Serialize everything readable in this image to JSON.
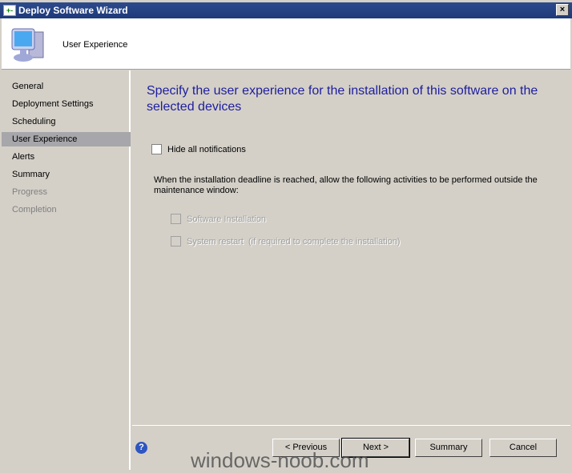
{
  "window": {
    "title": "Deploy Software Wizard",
    "close": "×"
  },
  "header": {
    "title": "User Experience"
  },
  "sidebar": {
    "items": [
      {
        "label": "General"
      },
      {
        "label": "Deployment Settings"
      },
      {
        "label": "Scheduling"
      },
      {
        "label": "User Experience",
        "selected": true
      },
      {
        "label": "Alerts"
      },
      {
        "label": "Summary"
      },
      {
        "label": "Progress",
        "disabled": true
      },
      {
        "label": "Completion",
        "disabled": true
      }
    ]
  },
  "main": {
    "heading": "Specify the user experience for the installation of this software on the selected devices",
    "hide_notifications": {
      "label": "Hide all notifications",
      "checked": false
    },
    "deadline_text": "When the installation deadline is reached, allow the following activities to be performed outside the maintenance window:",
    "software_installation": {
      "label": "Software Installation",
      "checked": false,
      "enabled": false
    },
    "system_restart": {
      "label": "System restart  (if required to complete the installation)",
      "checked": false,
      "enabled": false
    }
  },
  "footer": {
    "help": "?",
    "previous": "< Previous",
    "next": "Next >",
    "summary": "Summary",
    "cancel": "Cancel"
  },
  "watermark": "windows-noob.com"
}
